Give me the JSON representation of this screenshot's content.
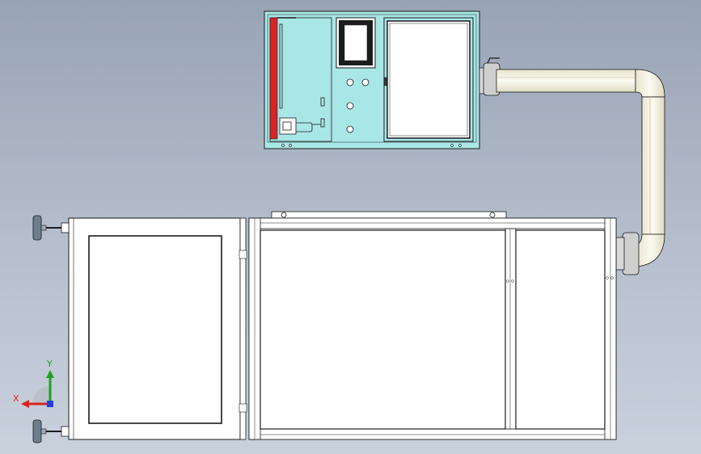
{
  "view": {
    "background_top": "#98a3b4",
    "background_bottom": "#c9d1dd"
  },
  "colors": {
    "panel_fill": "#a9e7e7",
    "accent_strip": "#d82424",
    "line": "#1a1a1a",
    "frame_fill": "#ffffff"
  },
  "triad": {
    "x_label": "X",
    "y_label": "Y",
    "x_color": "#e02020",
    "y_color": "#20a020",
    "z_color": "#2040e0"
  }
}
